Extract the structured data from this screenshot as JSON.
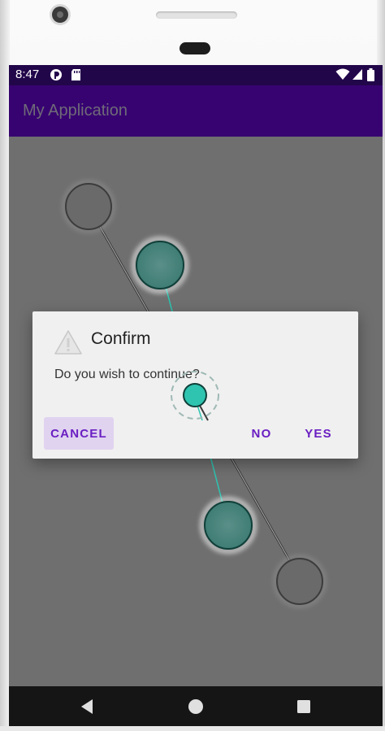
{
  "status_bar": {
    "time": "8:47",
    "icons": [
      "app-notification-icon",
      "sd-card-icon",
      "wifi-icon",
      "cell-signal-icon",
      "battery-icon"
    ]
  },
  "app_bar": {
    "title": "My Application",
    "color": "#370371"
  },
  "dialog": {
    "icon": "warning-icon",
    "title": "Confirm",
    "message": "Do you wish to continue?",
    "buttons": {
      "cancel": "CANCEL",
      "no": "NO",
      "yes": "YES"
    },
    "accent_color": "#6a1fc2"
  },
  "gesture_overlay": {
    "touch_color": "#2ec4b0"
  },
  "nav_bar": {
    "buttons": [
      "back-icon",
      "home-icon",
      "recents-icon"
    ]
  }
}
